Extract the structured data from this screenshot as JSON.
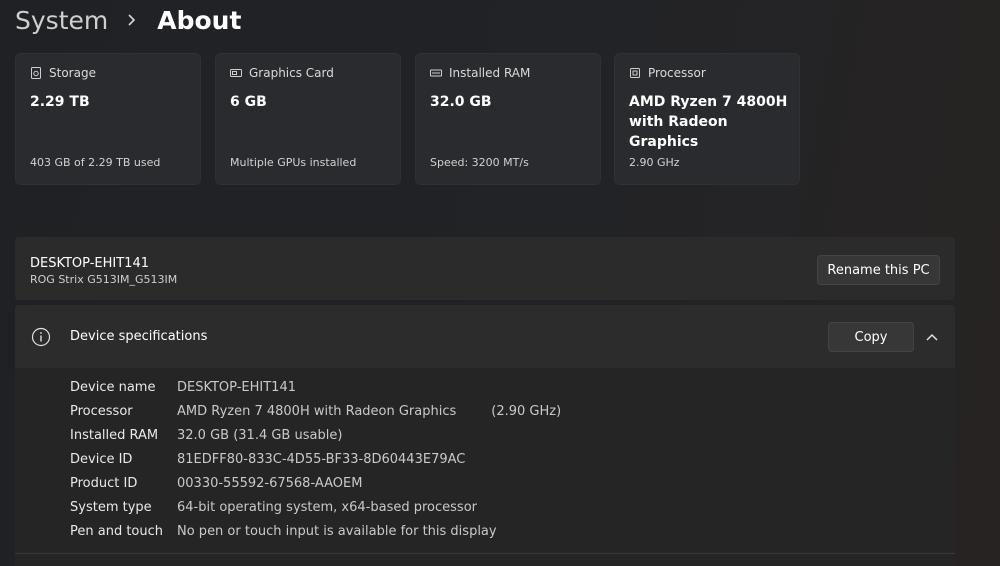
{
  "breadcrumb": {
    "parent": "System",
    "current": "About"
  },
  "cards": [
    {
      "icon": "storage-icon",
      "title": "Storage",
      "value": "2.29 TB",
      "sub": "403 GB of 2.29 TB used"
    },
    {
      "icon": "graphics-card-icon",
      "title": "Graphics Card",
      "value": "6 GB",
      "sub": "Multiple GPUs installed"
    },
    {
      "icon": "ram-icon",
      "title": "Installed RAM",
      "value": "32.0 GB",
      "sub": "Speed: 3200 MT/s"
    },
    {
      "icon": "processor-icon",
      "title": "Processor",
      "value": "AMD Ryzen 7 4800H with Radeon Graphics",
      "sub": "2.90 GHz"
    }
  ],
  "pc": {
    "name": "DESKTOP-EHIT141",
    "model": "ROG Strix G513IM_G513IM",
    "rename_label": "Rename this PC"
  },
  "specs": {
    "title": "Device specifications",
    "copy_label": "Copy",
    "rows": [
      {
        "label": "Device name",
        "value": "DESKTOP-EHIT141"
      },
      {
        "label": "Processor",
        "value": "AMD Ryzen 7 4800H with Radeon Graphics",
        "extra": "(2.90 GHz)"
      },
      {
        "label": "Installed RAM",
        "value": "32.0 GB (31.4 GB usable)"
      },
      {
        "label": "Device ID",
        "value": "81EDFF80-833C-4D55-BF33-8D60443E79AC"
      },
      {
        "label": "Product ID",
        "value": "00330-55592-67568-AAOEM"
      },
      {
        "label": "System type",
        "value": "64-bit operating system, x64-based processor"
      },
      {
        "label": "Pen and touch",
        "value": "No pen or touch input is available for this display"
      }
    ]
  }
}
